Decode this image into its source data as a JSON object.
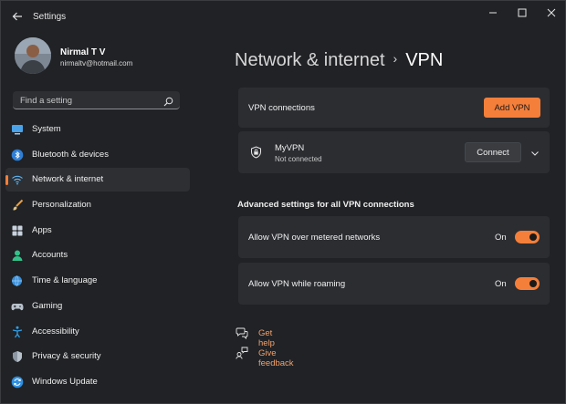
{
  "window": {
    "title": "Settings"
  },
  "profile": {
    "name": "Nirmal T V",
    "email": "nirmaltv@hotmail.com"
  },
  "search": {
    "placeholder": "Find a setting"
  },
  "sidebar": {
    "items": [
      {
        "label": "System",
        "icon": "monitor-icon"
      },
      {
        "label": "Bluetooth & devices",
        "icon": "bluetooth-icon"
      },
      {
        "label": "Network & internet",
        "icon": "wifi-icon",
        "active": true
      },
      {
        "label": "Personalization",
        "icon": "brush-icon"
      },
      {
        "label": "Apps",
        "icon": "apps-icon"
      },
      {
        "label": "Accounts",
        "icon": "person-icon"
      },
      {
        "label": "Time & language",
        "icon": "globe-clock-icon"
      },
      {
        "label": "Gaming",
        "icon": "gamepad-icon"
      },
      {
        "label": "Accessibility",
        "icon": "accessibility-icon"
      },
      {
        "label": "Privacy & security",
        "icon": "shield-icon"
      },
      {
        "label": "Windows Update",
        "icon": "update-icon"
      }
    ]
  },
  "breadcrumb": {
    "parent": "Network & internet",
    "current": "VPN"
  },
  "vpn_connections": {
    "label": "VPN connections",
    "add_button": "Add VPN"
  },
  "vpn_item": {
    "name": "MyVPN",
    "status": "Not connected",
    "connect_button": "Connect"
  },
  "advanced": {
    "title": "Advanced settings for all VPN connections",
    "settings": [
      {
        "label": "Allow VPN over metered networks",
        "state": "On",
        "enabled": true
      },
      {
        "label": "Allow VPN while roaming",
        "state": "On",
        "enabled": true
      }
    ]
  },
  "links": {
    "help": "Get help",
    "feedback": "Give feedback"
  },
  "colors": {
    "accent": "#f47f3a",
    "background": "#202225",
    "card": "#2b2d31"
  }
}
